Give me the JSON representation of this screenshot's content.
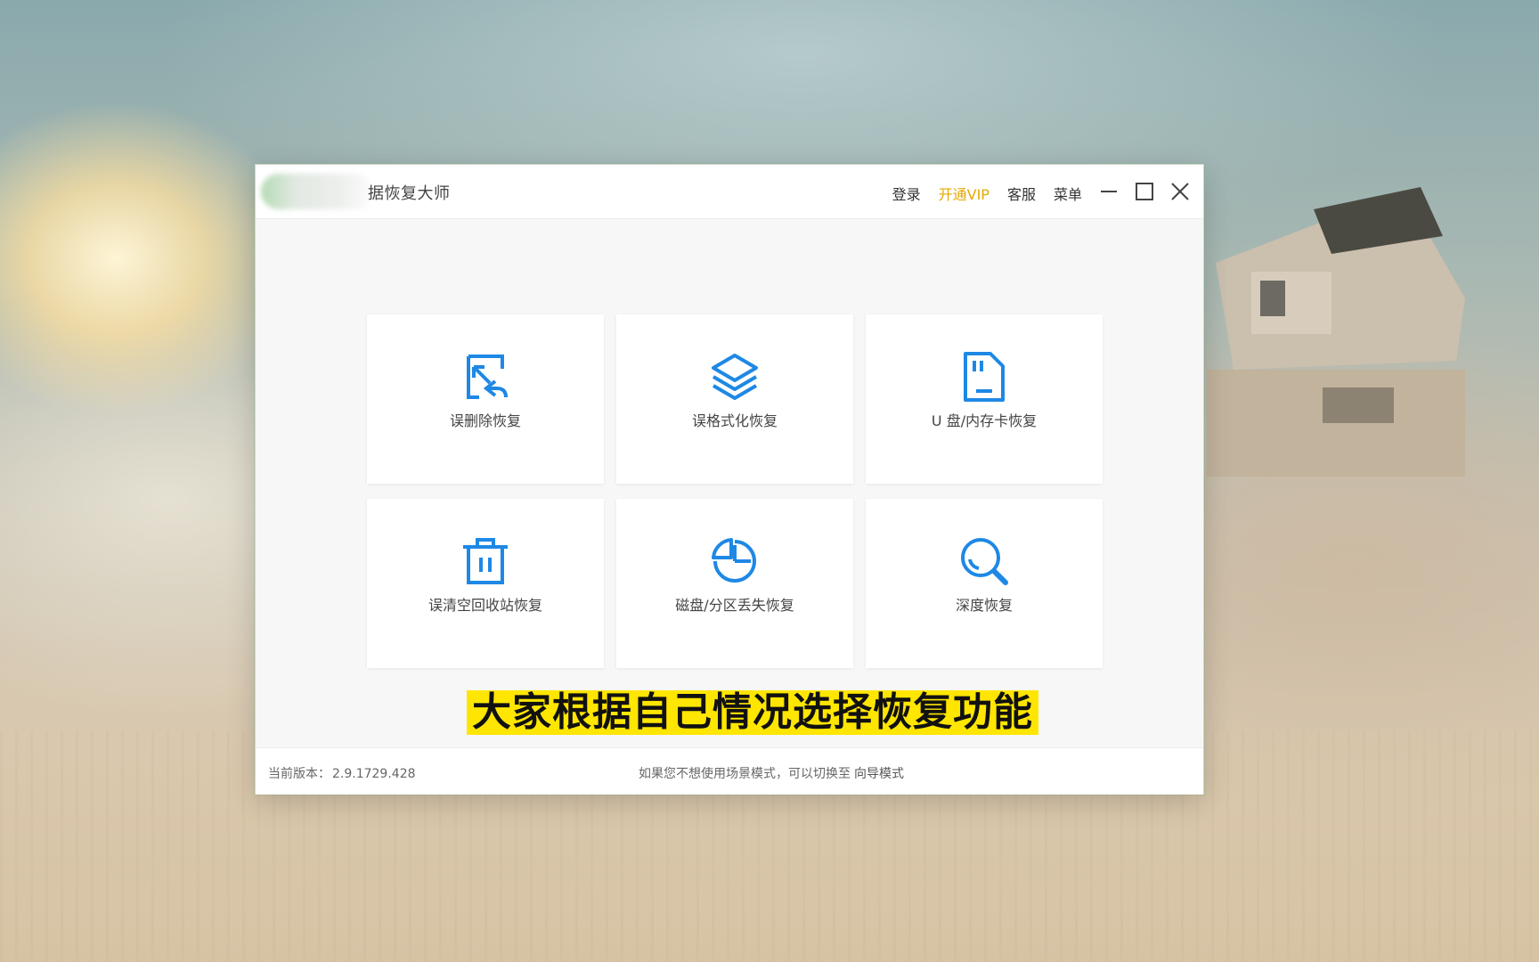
{
  "window": {
    "title": "据恢复大师",
    "nav": {
      "login": "登录",
      "vip": "开通VIP",
      "service": "客服",
      "menu": "菜单"
    }
  },
  "cards": [
    {
      "label": "误删除恢复",
      "icon": "file-restore-icon"
    },
    {
      "label": "误格式化恢复",
      "icon": "layers-icon"
    },
    {
      "label": "U 盘/内存卡恢复",
      "icon": "sd-card-icon"
    },
    {
      "label": "误清空回收站恢复",
      "icon": "trash-icon"
    },
    {
      "label": "磁盘/分区丢失恢复",
      "icon": "pie-chart-icon"
    },
    {
      "label": "深度恢复",
      "icon": "search-icon"
    }
  ],
  "caption": "大家根据自己情况选择恢复功能",
  "status": {
    "version_label": "当前版本：",
    "version": "2.9.1729.428",
    "hint": "如果您不想使用场景模式，可以切换至",
    "hint_link": "向导模式"
  },
  "colors": {
    "accent": "#1e88e5",
    "vip": "#e6a800",
    "caption_bg": "#ffe600"
  }
}
